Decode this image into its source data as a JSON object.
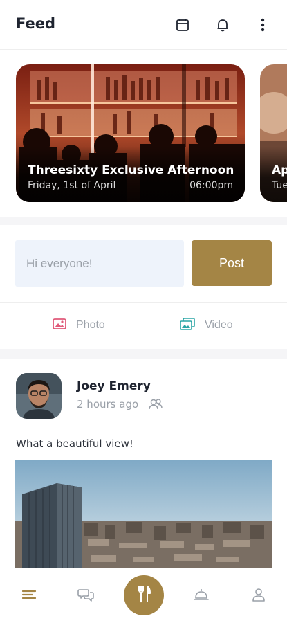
{
  "header": {
    "title": "Feed",
    "icons": [
      "calendar-icon",
      "bell-icon",
      "more-vertical-icon"
    ]
  },
  "events": [
    {
      "title": "Threesixty Exclusive Afternoon",
      "date": "Friday, 1st of April",
      "time": "06:00pm"
    },
    {
      "title": "Ap",
      "date": "Tue",
      "time": ""
    }
  ],
  "composer": {
    "placeholder": "Hi everyone!",
    "post_label": "Post"
  },
  "media": {
    "photo_label": "Photo",
    "video_label": "Video"
  },
  "post": {
    "author": "Joey Emery",
    "time": "2 hours ago",
    "text": "What a beautiful view!"
  },
  "bottom_nav": {
    "items": [
      "menu-icon",
      "chat-icon",
      "restaurant-icon",
      "service-bell-icon",
      "profile-icon"
    ]
  },
  "colors": {
    "accent": "#a48545",
    "input_bg": "#eef3fb",
    "muted_text": "#9aa0a8",
    "photo_icon": "#e05a7a",
    "video_icon": "#2aa5a5"
  }
}
